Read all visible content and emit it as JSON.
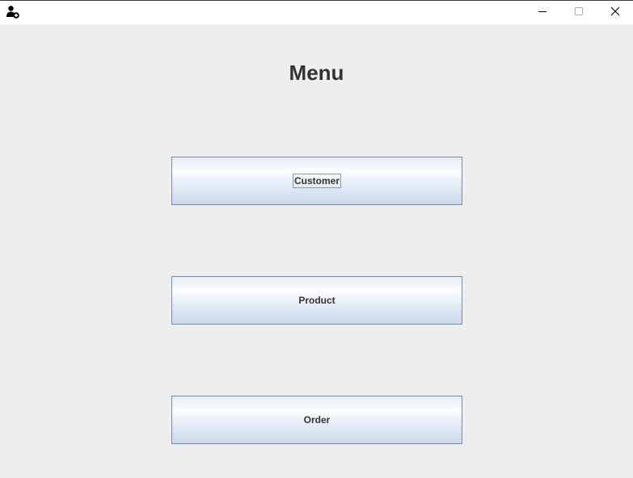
{
  "window": {
    "app_icon": "user-add-icon",
    "controls": {
      "minimize_icon": "minimize-icon",
      "maximize_icon": "maximize-icon",
      "close_icon": "close-icon"
    }
  },
  "main": {
    "title": "Menu",
    "buttons": [
      {
        "label": "Customer",
        "focused": true
      },
      {
        "label": "Product",
        "focused": false
      },
      {
        "label": "Order",
        "focused": false
      }
    ]
  }
}
